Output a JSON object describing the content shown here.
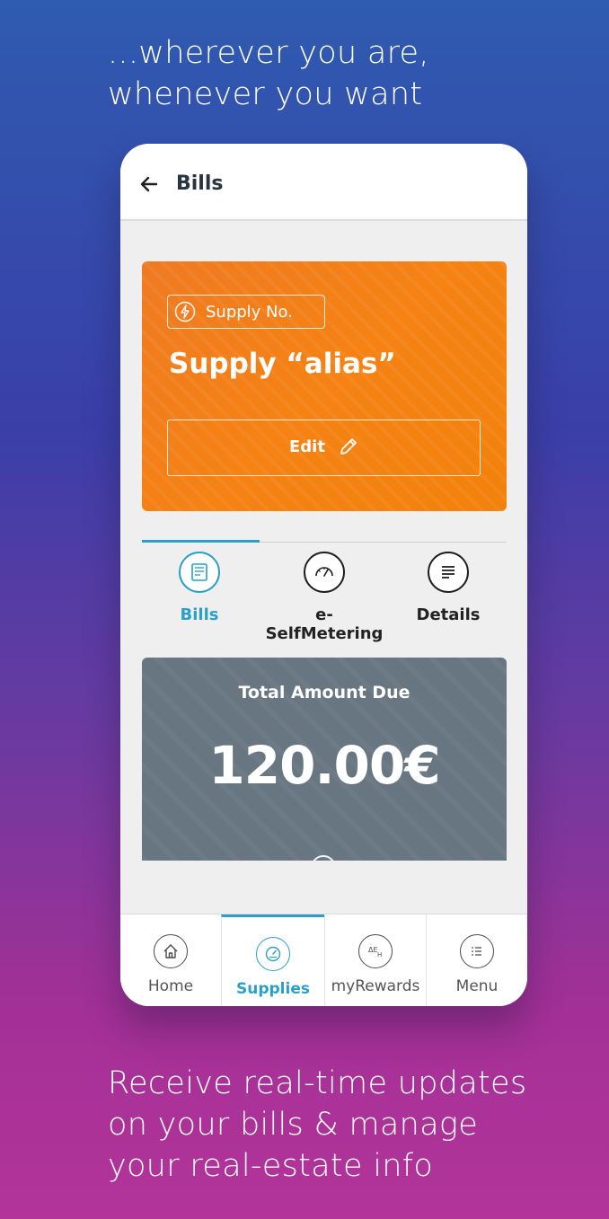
{
  "promo": {
    "top_text": "...wherever you are,\nwhenever you want",
    "bottom_text": "Receive real-time updates\non your bills & manage\nyour real-estate info"
  },
  "header": {
    "back_icon": "back-arrow-icon",
    "title": "Bills"
  },
  "supply_card": {
    "tag_icon": "lightning-bolt-icon",
    "tag_label": "Supply No.",
    "alias": "Supply “alias”",
    "edit_label": "Edit",
    "edit_icon": "pencil-icon",
    "color": "#f2820b"
  },
  "tabs": [
    {
      "label": "Bills",
      "icon": "bill-document-icon",
      "active": true
    },
    {
      "label": "e-SelfMetering",
      "icon": "speedometer-icon",
      "active": false
    },
    {
      "label": "Details",
      "icon": "details-list-icon",
      "active": false
    }
  ],
  "amount_card": {
    "label": "Total Amount Due",
    "value": "120.00€",
    "color": "#687681"
  },
  "bottom_nav": [
    {
      "label": "Home",
      "icon": "home-icon",
      "active": false
    },
    {
      "label": "Supplies",
      "icon": "gauge-icon",
      "active": true
    },
    {
      "label": "myRewards",
      "icon": "rewards-icon",
      "active": false
    },
    {
      "label": "Menu",
      "icon": "menu-list-icon",
      "active": false
    }
  ],
  "colors": {
    "accent": "#2aa0c8",
    "orange": "#f2820b",
    "text_dark": "#2a3340"
  }
}
